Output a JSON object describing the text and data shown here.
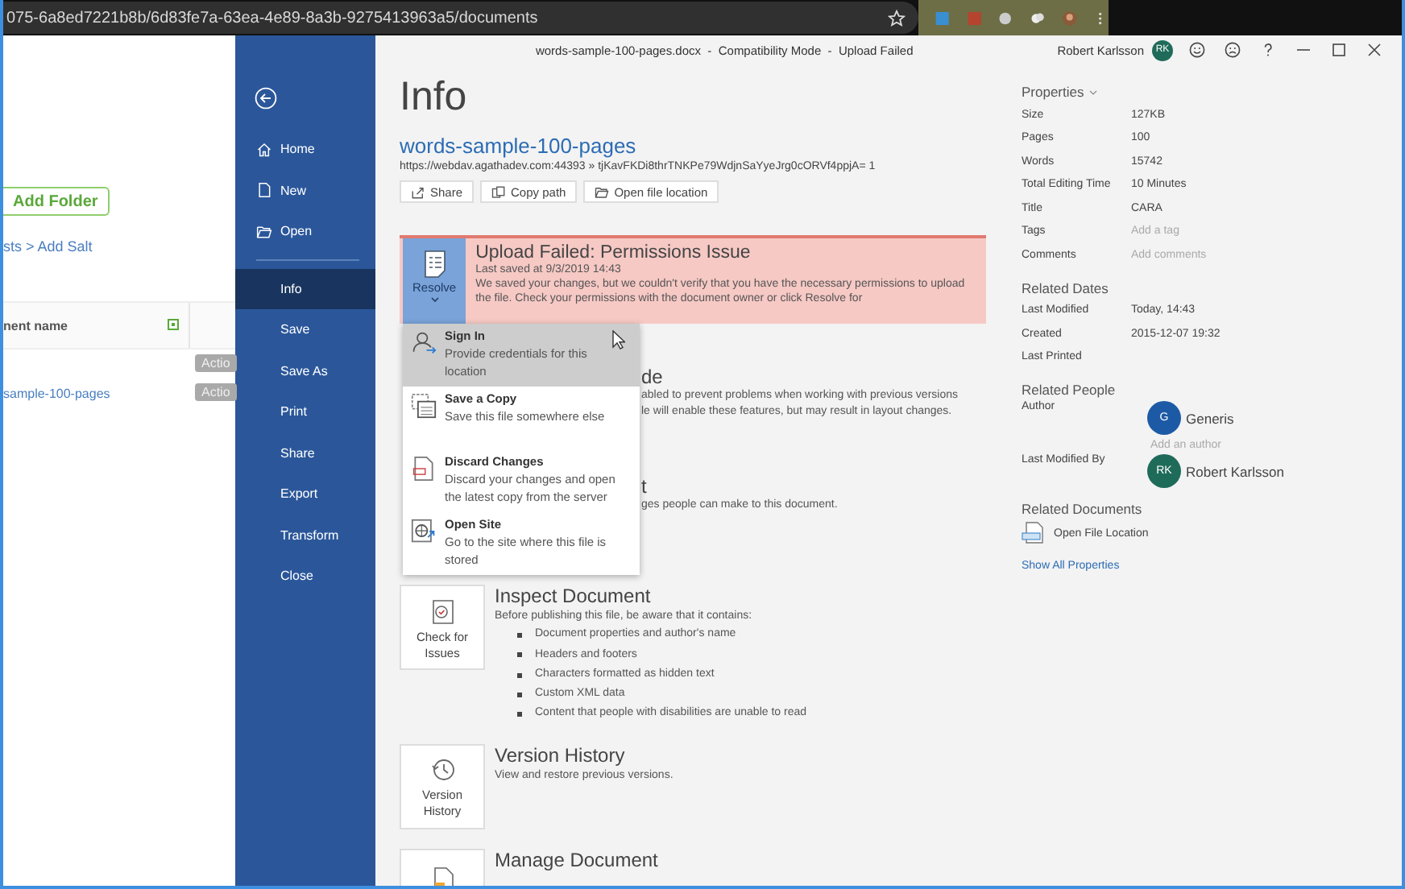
{
  "browser": {
    "url": "075-6a8ed7221b8b/6d83fe7a-63ea-4e89-8a3b-9275413963a5/documents"
  },
  "web_page": {
    "add_folder": "Add Folder",
    "breadcrumb": "sts > Add Salt",
    "table": {
      "columns": [
        "nent name"
      ],
      "rows": [
        {
          "action": "Actio"
        },
        {
          "name": "sample-100-pages",
          "action": "Actio"
        }
      ]
    }
  },
  "word": {
    "title": "words-sample-100-pages.docx  -  Compatibility Mode  -  Upload Failed",
    "user": {
      "name": "Robert Karlsson",
      "initials": "RK",
      "color": "#1f6b5a"
    },
    "nav": [
      {
        "label": "Home",
        "kind": "home",
        "selected": false
      },
      {
        "label": "New",
        "kind": "new",
        "selected": false
      },
      {
        "label": "Open",
        "kind": "open",
        "selected": false
      },
      {
        "label": "Info",
        "kind": "text",
        "selected": true
      },
      {
        "label": "Save",
        "kind": "text",
        "selected": false
      },
      {
        "label": "Save As",
        "kind": "text",
        "selected": false
      },
      {
        "label": "Print",
        "kind": "text",
        "selected": false
      },
      {
        "label": "Share",
        "kind": "text",
        "selected": false
      },
      {
        "label": "Export",
        "kind": "text",
        "selected": false
      },
      {
        "label": "Transform",
        "kind": "text",
        "selected": false
      },
      {
        "label": "Close",
        "kind": "text",
        "selected": false
      }
    ],
    "info": {
      "heading": "Info",
      "doc_name": "words-sample-100-pages",
      "path": "https://webdav.agathadev.com:44393 » tjKavFKDi8thrTNKPe79WdjnSaYyeJrg0cORVf4ppjA= 1",
      "actions": [
        {
          "label": "Share",
          "kind": "share"
        },
        {
          "label": "Copy path",
          "kind": "copy"
        },
        {
          "label": "Open file location",
          "kind": "folder"
        }
      ],
      "alert": {
        "button": "Resolve",
        "title": "Upload Failed: Permissions Issue",
        "subtitle": "Last saved at 9/3/2019 14:43",
        "message": "We saved your changes, but we couldn't verify that you have the necessary permissions to upload the file. Check your permissions with the document owner or click Resolve for"
      },
      "menu": [
        {
          "kind": "signin",
          "title": "Sign In",
          "text": "Provide credentials for this location",
          "selected": true
        },
        {
          "kind": "copy",
          "title": "Save a Copy",
          "text": "Save this file somewhere else",
          "selected": false
        },
        {
          "kind": "discard",
          "title": "Discard Changes",
          "text": "Discard your changes and open the latest copy from the server",
          "selected": false
        },
        {
          "kind": "site",
          "title": "Open Site",
          "text": "Go to the site where this file is stored",
          "selected": false
        }
      ],
      "compat": {
        "title": "de",
        "lines": [
          "abled to prevent problems when working with previous versions",
          "le will enable these features, but may result in layout changes."
        ]
      },
      "protect": {
        "title": "t",
        "lines": [
          "ges people can make to this document."
        ]
      },
      "inspect": {
        "button": "Check for Issues",
        "title": "Inspect Document",
        "intro": "Before publishing this file, be aware that it contains:",
        "bullets": [
          "Document properties and author's name",
          "Headers and footers",
          "Characters formatted as hidden text",
          "Custom XML data",
          "Content that people with disabilities are unable to read"
        ]
      },
      "versions": {
        "button": "Version History",
        "title": "Version History",
        "text": "View and restore previous versions."
      },
      "manage": {
        "title": "Manage Document"
      }
    },
    "properties": {
      "heading": "Properties",
      "rows": [
        {
          "label": "Size",
          "value": "127KB"
        },
        {
          "label": "Pages",
          "value": "100"
        },
        {
          "label": "Words",
          "value": "15742"
        },
        {
          "label": "Total Editing Time",
          "value": "10 Minutes"
        },
        {
          "label": "Title",
          "value": "CARA"
        },
        {
          "label": "Tags",
          "placeholder": "Add a tag"
        },
        {
          "label": "Comments",
          "placeholder": "Add comments"
        }
      ],
      "dates_heading": "Related Dates",
      "dates": [
        {
          "label": "Last Modified",
          "value": "Today, 14:43"
        },
        {
          "label": "Created",
          "value": "2015-12-07 19:32"
        },
        {
          "label": "Last Printed"
        }
      ],
      "people_heading": "Related People",
      "people": [
        {
          "label": "Author",
          "initials": "G",
          "name": "Generis",
          "color": "#1d5aa6",
          "add": "Add an author"
        },
        {
          "label": "Last Modified By",
          "initials": "RK",
          "name": "Robert Karlsson",
          "color": "#1f6b5a"
        }
      ],
      "docs_heading": "Related Documents",
      "open_location": "Open File Location",
      "show_all": "Show All Properties"
    }
  }
}
